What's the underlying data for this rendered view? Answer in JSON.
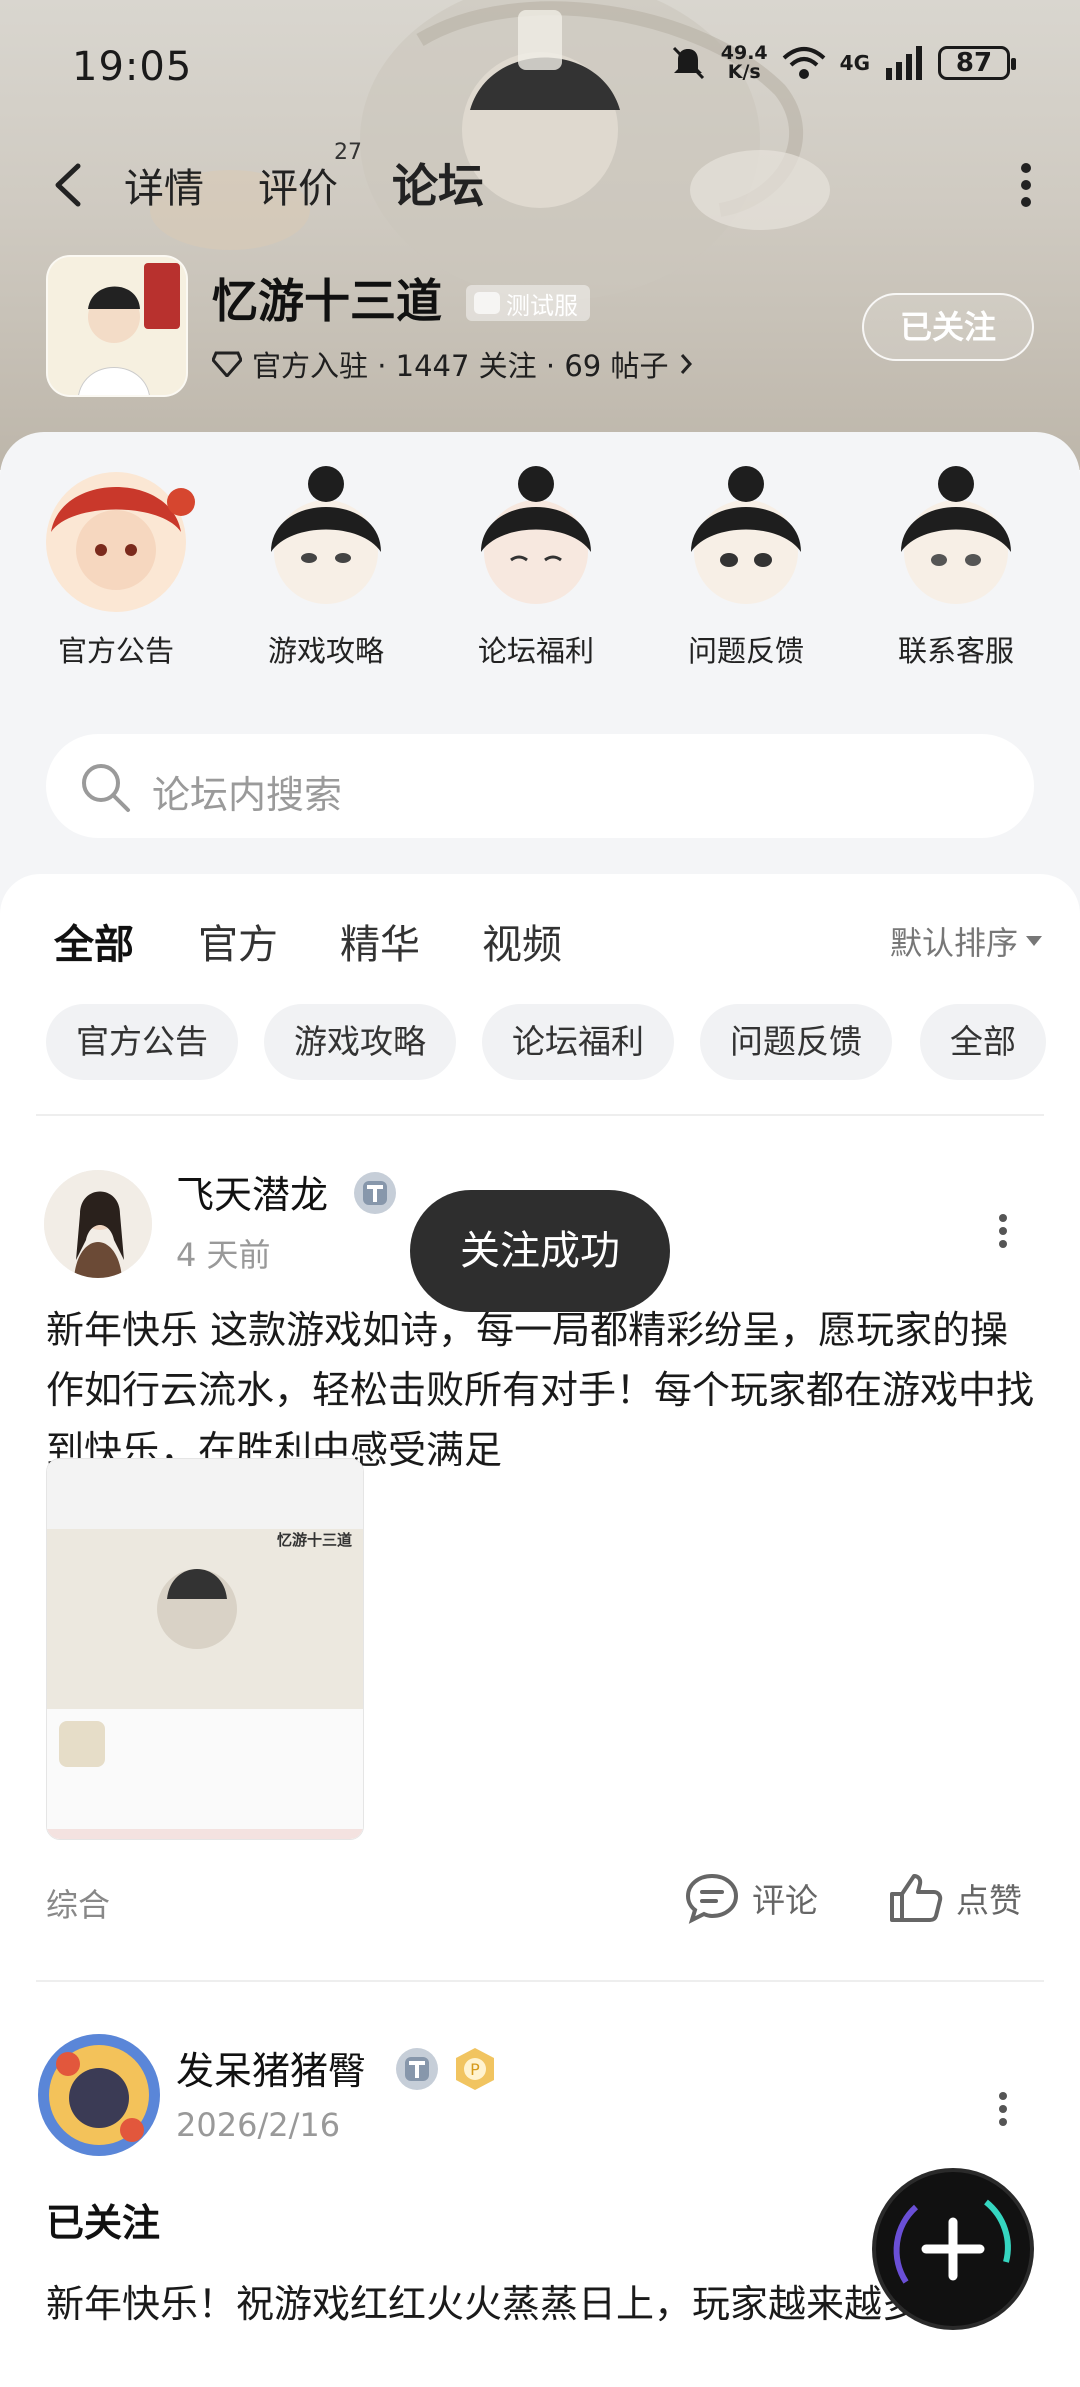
{
  "status_bar": {
    "time": "19:05",
    "net_speed_value": "49.4",
    "net_speed_unit": "K/s",
    "network": "4G",
    "battery": "87"
  },
  "nav": {
    "tabs": [
      "详情",
      "评价",
      "论坛"
    ],
    "review_count": "27",
    "active_tab": "论坛"
  },
  "app": {
    "name": "忆游十三道",
    "test_badge": "测试服",
    "meta": "官方入驻 · 1447 关注 · 69 帖子",
    "follow_label": "已关注"
  },
  "categories": [
    {
      "label": "官方公告",
      "icon": "official-announcement-icon"
    },
    {
      "label": "游戏攻略",
      "icon": "game-guide-icon"
    },
    {
      "label": "论坛福利",
      "icon": "forum-welfare-icon"
    },
    {
      "label": "问题反馈",
      "icon": "feedback-icon"
    },
    {
      "label": "联系客服",
      "icon": "customer-service-icon"
    }
  ],
  "search": {
    "placeholder": "论坛内搜索"
  },
  "feed_tabs": [
    "全部",
    "官方",
    "精华",
    "视频"
  ],
  "sort_label": "默认排序",
  "chips": [
    "官方公告",
    "游戏攻略",
    "论坛福利",
    "问题反馈",
    "全部"
  ],
  "posts": [
    {
      "author": "飞天潜龙",
      "time": "4 天前",
      "body": "新年快乐  这款游戏如诗，每一局都精彩纷呈，愿玩家的操作如行云流水，轻松击败所有对手！每个玩家都在游戏中找到快乐，在胜利中感受满足",
      "image_title": "忆游十三道",
      "category": "综合",
      "comment_label": "评论",
      "like_label": "点赞"
    },
    {
      "author": "发呆猪猪臀",
      "time": "2026/2/16",
      "headline": "已关注",
      "body": "新年快乐！祝游戏红红火火蒸蒸日上，玩家越来越多！"
    }
  ],
  "toast": "关注成功",
  "colors": {
    "accent": "#2fd0b7",
    "toast_bg": "#2e2e2e",
    "page_bg": "#f4f5f7"
  }
}
